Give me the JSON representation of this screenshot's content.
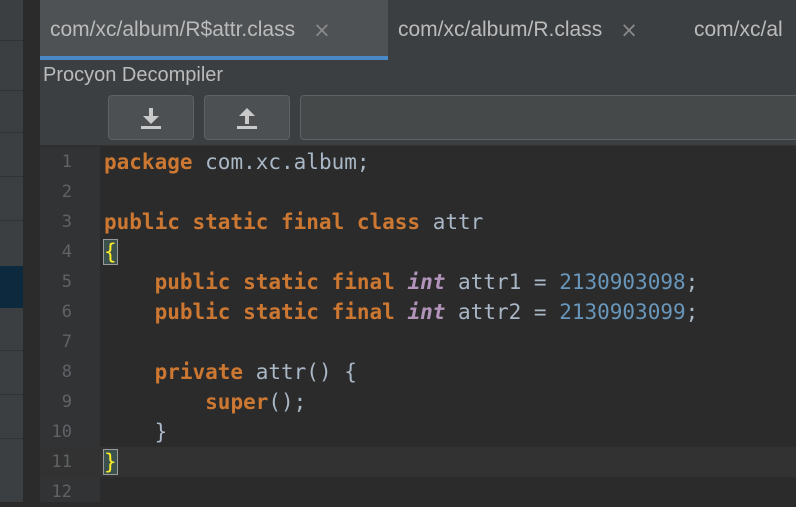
{
  "tabs": [
    {
      "label": "com/xc/album/R$attr.class",
      "close": "×",
      "active": true
    },
    {
      "label": "com/xc/album/R.class",
      "close": "×",
      "active": false
    },
    {
      "label": "com/xc/al",
      "close": "",
      "active": false
    }
  ],
  "decompiler": {
    "title": "Procyon Decompiler"
  },
  "toolbar": {
    "download_icon": "download-icon",
    "upload_icon": "upload-icon"
  },
  "editor": {
    "current_line": 11,
    "lines": [
      {
        "num": "1",
        "tokens": [
          {
            "t": "package",
            "c": "kw"
          },
          {
            "t": " com.xc.album;",
            "c": ""
          }
        ]
      },
      {
        "num": "2",
        "tokens": []
      },
      {
        "num": "3",
        "tokens": [
          {
            "t": "public static final class",
            "c": "kw"
          },
          {
            "t": " attr",
            "c": ""
          }
        ]
      },
      {
        "num": "4",
        "tokens": [
          {
            "t": "{",
            "c": "brace"
          }
        ]
      },
      {
        "num": "5",
        "tokens": [
          {
            "t": "    ",
            "c": ""
          },
          {
            "t": "public static final",
            "c": "kw"
          },
          {
            "t": " ",
            "c": ""
          },
          {
            "t": "int",
            "c": "ty"
          },
          {
            "t": " attr1 = ",
            "c": ""
          },
          {
            "t": "2130903098",
            "c": "num"
          },
          {
            "t": ";",
            "c": ""
          }
        ]
      },
      {
        "num": "6",
        "tokens": [
          {
            "t": "    ",
            "c": ""
          },
          {
            "t": "public static final",
            "c": "kw"
          },
          {
            "t": " ",
            "c": ""
          },
          {
            "t": "int",
            "c": "ty"
          },
          {
            "t": " attr2 = ",
            "c": ""
          },
          {
            "t": "2130903099",
            "c": "num"
          },
          {
            "t": ";",
            "c": ""
          }
        ]
      },
      {
        "num": "7",
        "tokens": []
      },
      {
        "num": "8",
        "tokens": [
          {
            "t": "    ",
            "c": ""
          },
          {
            "t": "private",
            "c": "kw"
          },
          {
            "t": " attr() {",
            "c": ""
          }
        ]
      },
      {
        "num": "9",
        "tokens": [
          {
            "t": "        ",
            "c": ""
          },
          {
            "t": "super",
            "c": "kw"
          },
          {
            "t": "();",
            "c": ""
          }
        ]
      },
      {
        "num": "10",
        "tokens": [
          {
            "t": "    }",
            "c": ""
          }
        ]
      },
      {
        "num": "11",
        "tokens": [
          {
            "t": "}",
            "c": "brace"
          }
        ]
      },
      {
        "num": "12",
        "tokens": []
      }
    ]
  },
  "colors": {
    "accent": "#4a88c7",
    "keyword": "#cc7832",
    "number": "#6897bb",
    "type": "#b294bb",
    "text": "#a9b7c6"
  }
}
